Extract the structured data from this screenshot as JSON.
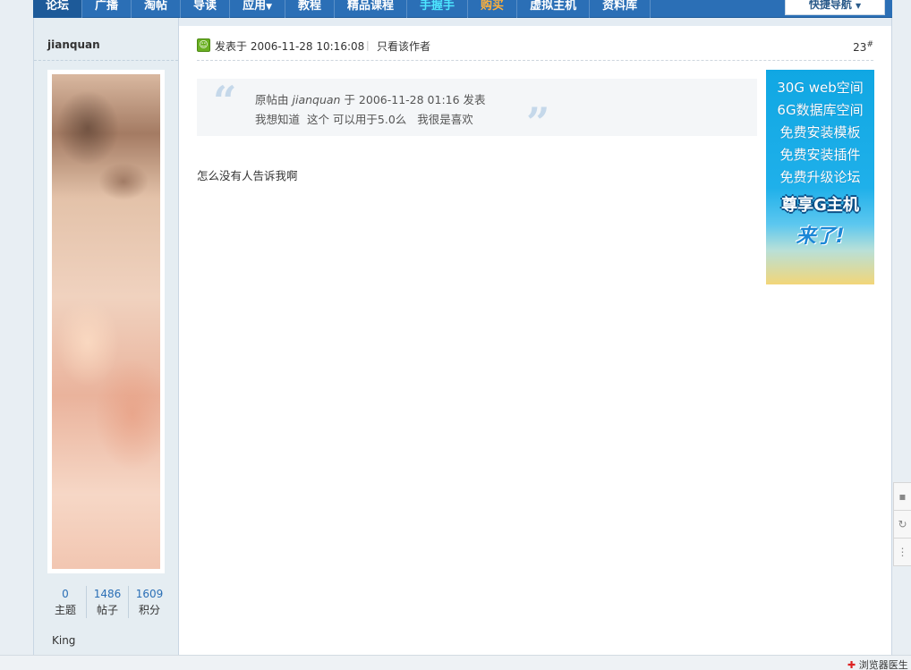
{
  "nav": {
    "items": [
      {
        "label": "论坛",
        "style": "active"
      },
      {
        "label": "广播",
        "style": "normal"
      },
      {
        "label": "淘帖",
        "style": "normal"
      },
      {
        "label": "导读",
        "style": "normal"
      },
      {
        "label": "应用",
        "style": "normal",
        "dropdown": true
      },
      {
        "label": "教程",
        "style": "normal"
      },
      {
        "label": "精品课程",
        "style": "normal"
      },
      {
        "label": "手握手",
        "style": "cyan"
      },
      {
        "label": "购买",
        "style": "orange"
      },
      {
        "label": "虚拟主机",
        "style": "normal"
      },
      {
        "label": "资料库",
        "style": "normal"
      }
    ],
    "quick_nav_label": "快捷导航",
    "quick_nav_caret": "▼"
  },
  "user": {
    "name": "jianquan",
    "stats": [
      {
        "value": "0",
        "label": "主题"
      },
      {
        "value": "1486",
        "label": "帖子"
      },
      {
        "value": "1609",
        "label": "积分"
      }
    ],
    "rank": "King"
  },
  "post": {
    "posted_at": "发表于 2006-11-28 10:16:08",
    "separator": "|",
    "author_only": "只看该作者",
    "floor": "23",
    "floor_suffix": "#",
    "quote": {
      "prefix": "原帖由",
      "author": "jianquan",
      "suffix": "于 2006-11-28 01:16 发表",
      "text": "我想知道  这个 可以用于5.0么   我很是喜欢"
    },
    "reply": "怎么没有人告诉我啊"
  },
  "ad": {
    "lines": [
      "30G web空间",
      "6G数据库空间",
      "免费安装模板",
      "免费安装插件",
      "免费升级论坛"
    ],
    "highlight": "尊享G主机",
    "tagline": "来了!"
  },
  "footer": {
    "browser_doctor": "浏览器医生"
  },
  "colors": {
    "nav_bg": "#2b6fb6",
    "sidebar_bg": "#e5edf2",
    "link_blue": "#2b6fb6",
    "ad_bg": "#10a7e3"
  }
}
